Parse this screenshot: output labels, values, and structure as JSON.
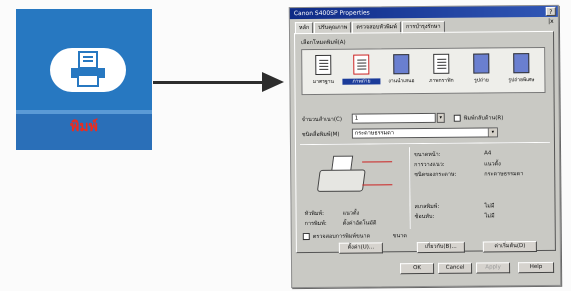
{
  "left_tile": {
    "label": "พิมพ์",
    "icon": "printer-icon"
  },
  "dialog": {
    "title": "Canon S400SP Properties",
    "tabs": [
      "หลัก",
      "ปรับคุณภาพ",
      "ตรวจสอบหัวพิมพ์",
      "การบำรุงรักษา"
    ],
    "profiles_label": "เลือกโหมดพิมพ์(A)",
    "profiles": [
      "มาตรฐาน",
      "ภาพถ่าย",
      "งานนำเสนอ",
      "ภาพกราฟิก",
      "รูปถ่าย",
      "รูปถ่ายพิเศษ"
    ],
    "selected_profile": 1,
    "copies_label": "จำนวนสำเนา(C)",
    "copies_value": "1",
    "collate_label": "พิมพ์กลับด้าน(R)",
    "media_label": "ชนิดสื่อพิมพ์(M)",
    "media_value": "กระดาษธรรมดา",
    "info": [
      {
        "key": "ขนาดหน้า:",
        "value": "A4"
      },
      {
        "key": "การวางแนว:",
        "value": "แนวตั้ง"
      },
      {
        "key": "ชนิดของกระดาษ:",
        "value": "กระดาษธรรมดา"
      },
      {
        "key": "สเกลพิมพ์:",
        "value": "ไม่มี"
      },
      {
        "key": "ซ้อนทับ:",
        "value": "ไม่มี"
      }
    ],
    "bottom_left": [
      {
        "key": "หัวพิมพ์:",
        "value": "แนวตั้ง"
      },
      {
        "key": "การพิมพ์:",
        "value": "ตั้งค่าอัตโนมัติ"
      }
    ],
    "status_text": "ตรวจสอบการพิมพ์ขนาด",
    "status_value": "ขนาด",
    "mid_buttons": [
      "ตั้งค่า(U)...",
      "เกี่ยวกับ(B)...",
      "ค่าเริ่มต้น(D)"
    ],
    "footer_buttons": [
      "OK",
      "Cancel",
      "Apply",
      "Help"
    ],
    "close_glyph": "?|x"
  }
}
